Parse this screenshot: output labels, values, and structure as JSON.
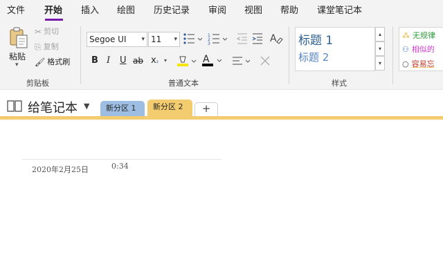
{
  "menu": {
    "items": [
      {
        "label": "文件"
      },
      {
        "label": "开始"
      },
      {
        "label": "插入"
      },
      {
        "label": "绘图"
      },
      {
        "label": "历史记录"
      },
      {
        "label": "审阅"
      },
      {
        "label": "视图"
      },
      {
        "label": "帮助"
      },
      {
        "label": "课堂笔记本"
      }
    ],
    "active": "开始"
  },
  "ribbon": {
    "clipboard": {
      "paste_label": "粘贴",
      "cut_label": "剪切",
      "copy_label": "复制",
      "format_painter_label": "格式刷",
      "group_label": "剪贴板"
    },
    "basic_text": {
      "font_name": "Segoe UI",
      "font_size": "11",
      "bold": "B",
      "italic": "I",
      "underline": "U",
      "strikethrough": "ab",
      "subscript": "x",
      "subscript_mark": "₂",
      "group_label": "普通文本"
    },
    "styles": {
      "heading1": "标题 1",
      "heading2": "标题 2",
      "group_label": "样式"
    },
    "tags": {
      "items": [
        {
          "label": "无规律",
          "color": "#2e9e3d"
        },
        {
          "label": "相似的",
          "color": "#d63ad6"
        },
        {
          "label": "容易忘",
          "color": "#c0392b"
        }
      ]
    }
  },
  "notebook": {
    "title": "给笔记本",
    "sections": [
      {
        "label": "新分区 1",
        "color": "#9dbde3"
      },
      {
        "label": "新分区 2",
        "color": "#f3cc6f"
      }
    ],
    "add_label": "+"
  },
  "page": {
    "date": "2020年2月25日",
    "time": "0:34"
  },
  "colors": {
    "accent": "#7719aa",
    "highlight": "#f5e400",
    "font_color": "#000000",
    "heading": "#2e5f91"
  }
}
